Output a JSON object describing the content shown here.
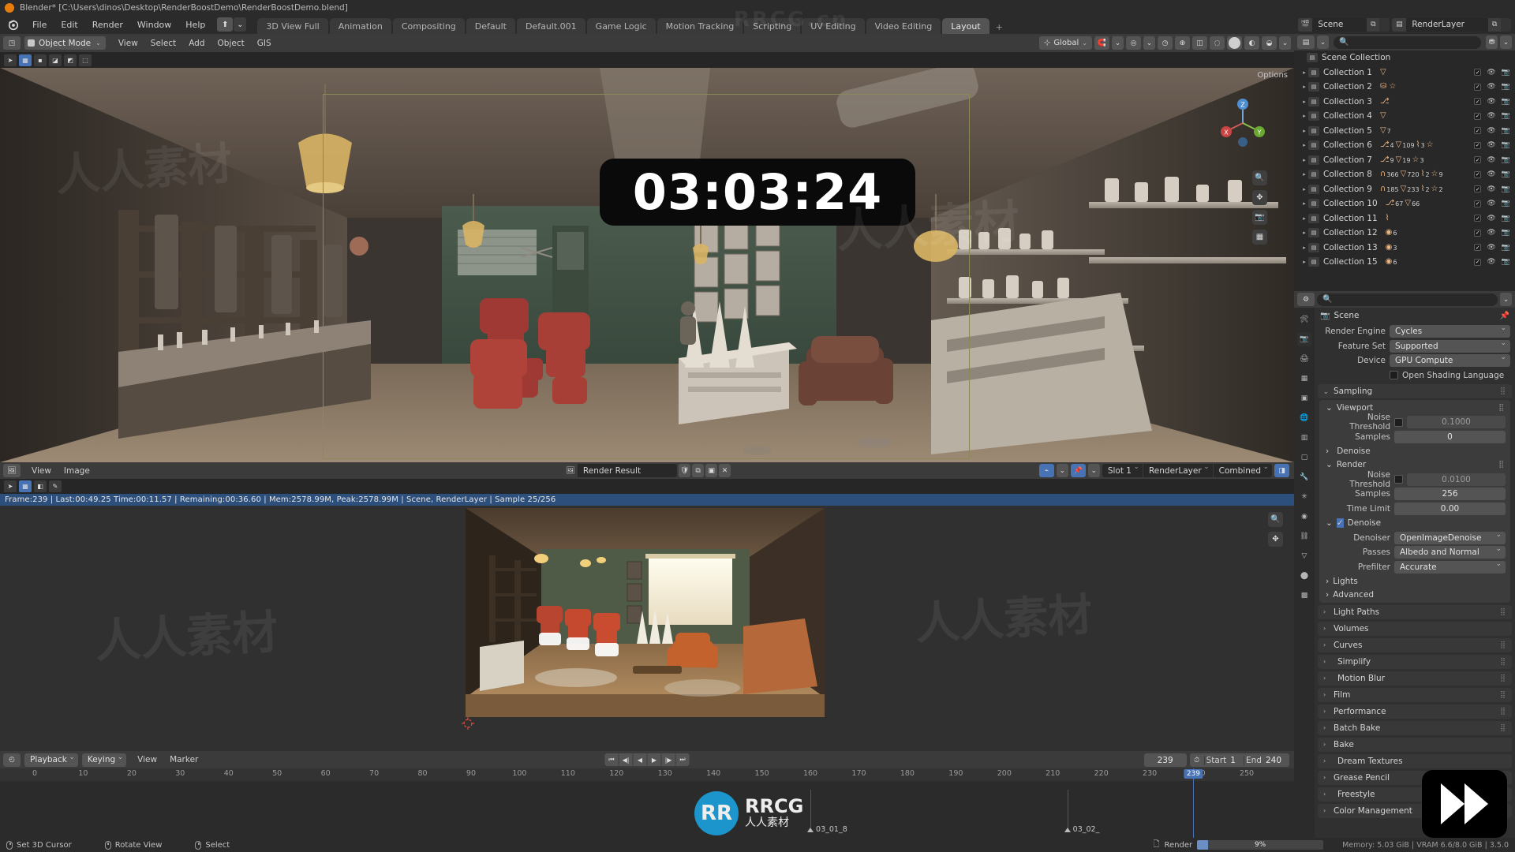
{
  "titlebar": {
    "text": "Blender* [C:\\Users\\dinos\\Desktop\\RenderBoostDemo\\RenderBoostDemo.blend]"
  },
  "topbar": {
    "menus": [
      "File",
      "Edit",
      "Render",
      "Window",
      "Help"
    ],
    "workspaces": [
      {
        "label": "3D View Full",
        "active": false
      },
      {
        "label": "Animation",
        "active": false
      },
      {
        "label": "Compositing",
        "active": false
      },
      {
        "label": "Default",
        "active": false
      },
      {
        "label": "Default.001",
        "active": false
      },
      {
        "label": "Game Logic",
        "active": false
      },
      {
        "label": "Motion Tracking",
        "active": false
      },
      {
        "label": "Scripting",
        "active": false
      },
      {
        "label": "UV Editing",
        "active": false
      },
      {
        "label": "Video Editing",
        "active": false
      },
      {
        "label": "Layout",
        "active": true
      },
      {
        "label": "+",
        "active": false
      }
    ],
    "scene_name": "Scene",
    "view_layer_name": "RenderLayer"
  },
  "viewport": {
    "mode": "Object Mode",
    "menus": [
      "View",
      "Select",
      "Add",
      "Object",
      "GIS"
    ],
    "transform_orientation": "Global",
    "options_label": "Options",
    "timer_overlay": "03:03:24"
  },
  "image_editor": {
    "menus": [
      "View",
      "Image"
    ],
    "image_name": "Render Result",
    "slot": "Slot 1",
    "layer": "RenderLayer",
    "pass": "Combined",
    "render_status": "Frame:239 | Last:00:49.25 Time:00:11.57 | Remaining:00:36.60 | Mem:2578.99M, Peak:2578.99M | Scene, RenderLayer | Sample 25/256"
  },
  "timeline": {
    "popovers": [
      "Playback",
      "Keying"
    ],
    "menus": [
      "View",
      "Marker"
    ],
    "current_frame": "239",
    "start_label": "Start",
    "start_value": "1",
    "end_label": "End",
    "end_value": "240",
    "ruler_ticks": [
      "0",
      "10",
      "20",
      "30",
      "40",
      "50",
      "60",
      "70",
      "80",
      "90",
      "100",
      "110",
      "120",
      "130",
      "140",
      "150",
      "160",
      "170",
      "180",
      "190",
      "200",
      "210",
      "220",
      "230",
      "240",
      "250"
    ],
    "playhead_label": "239",
    "markers": [
      {
        "name": "03_01_8",
        "frame": 160
      },
      {
        "name": "03_02_",
        "frame": 213
      }
    ]
  },
  "outliner": {
    "search_placeholder": "",
    "root": "Scene Collection",
    "items": [
      {
        "label": "Collection 1",
        "counts": [
          {
            "icon": "▽",
            "num": ""
          }
        ]
      },
      {
        "label": "Collection 2",
        "counts": [
          {
            "icon": "⛁",
            "num": ""
          },
          {
            "icon": "☆",
            "num": ""
          }
        ]
      },
      {
        "label": "Collection 3",
        "counts": [
          {
            "icon": "⎇",
            "num": ""
          }
        ]
      },
      {
        "label": "Collection 4",
        "counts": [
          {
            "icon": "▽",
            "num": ""
          }
        ]
      },
      {
        "label": "Collection 5",
        "counts": [
          {
            "icon": "▽",
            "num": "7"
          }
        ]
      },
      {
        "label": "Collection 6",
        "counts": [
          {
            "icon": "⎇",
            "num": "4"
          },
          {
            "icon": "▽",
            "num": "109"
          },
          {
            "icon": "⌇",
            "num": "3"
          },
          {
            "icon": "☆",
            "num": ""
          }
        ]
      },
      {
        "label": "Collection 7",
        "counts": [
          {
            "icon": "⎇",
            "num": "9"
          },
          {
            "icon": "▽",
            "num": "19"
          },
          {
            "icon": "☆",
            "num": "3"
          }
        ]
      },
      {
        "label": "Collection 8",
        "counts": [
          {
            "icon": "∩",
            "num": "366"
          },
          {
            "icon": "▽",
            "num": "720"
          },
          {
            "icon": "⌇",
            "num": "2"
          },
          {
            "icon": "☆",
            "num": "9"
          }
        ]
      },
      {
        "label": "Collection 9",
        "counts": [
          {
            "icon": "∩",
            "num": "185"
          },
          {
            "icon": "▽",
            "num": "233"
          },
          {
            "icon": "⌇",
            "num": "2"
          },
          {
            "icon": "☆",
            "num": "2"
          }
        ]
      },
      {
        "label": "Collection 10",
        "counts": [
          {
            "icon": "⎇",
            "num": "67"
          },
          {
            "icon": "▽",
            "num": "66"
          }
        ]
      },
      {
        "label": "Collection 11",
        "counts": [
          {
            "icon": "⌇",
            "num": ""
          }
        ]
      },
      {
        "label": "Collection 12",
        "counts": [
          {
            "icon": "◉",
            "num": "6"
          }
        ]
      },
      {
        "label": "Collection 13",
        "counts": [
          {
            "icon": "◉",
            "num": "3"
          }
        ]
      },
      {
        "label": "Collection 15",
        "counts": [
          {
            "icon": "◉",
            "num": "6"
          }
        ]
      }
    ]
  },
  "properties": {
    "search_placeholder": "",
    "breadcrumb": "Scene",
    "render_engine_label": "Render Engine",
    "render_engine": "Cycles",
    "feature_set_label": "Feature Set",
    "feature_set": "Supported",
    "device_label": "Device",
    "device": "GPU Compute",
    "osl_label": "Open Shading Language",
    "sampling_label": "Sampling",
    "viewport_label": "Viewport",
    "viewport_noise_threshold_label": "Noise Threshold",
    "viewport_noise_threshold": "0.1000",
    "viewport_samples_label": "Samples",
    "viewport_samples": "0",
    "viewport_denoise_label": "Denoise",
    "render_label": "Render",
    "render_noise_threshold_label": "Noise Threshold",
    "render_noise_threshold": "0.0100",
    "render_samples_label": "Samples",
    "render_samples": "256",
    "time_limit_label": "Time Limit",
    "time_limit": "0.00",
    "denoise_label": "Denoise",
    "denoiser_label": "Denoiser",
    "denoiser": "OpenImageDenoise",
    "passes_label": "Passes",
    "passes": "Albedo and Normal",
    "prefilter_label": "Prefilter",
    "prefilter": "Accurate",
    "sub_panels": [
      "Lights",
      "Advanced"
    ],
    "panels": [
      {
        "label": "Light Paths",
        "checkbox": false,
        "dots": true
      },
      {
        "label": "Volumes",
        "checkbox": false,
        "dots": false
      },
      {
        "label": "Curves",
        "checkbox": false,
        "dots": true
      },
      {
        "label": "Simplify",
        "checkbox": true,
        "dots": true
      },
      {
        "label": "Motion Blur",
        "checkbox": true,
        "dots": true
      },
      {
        "label": "Film",
        "checkbox": false,
        "dots": true
      },
      {
        "label": "Performance",
        "checkbox": false,
        "dots": true
      },
      {
        "label": "Batch Bake",
        "checkbox": false,
        "dots": true
      },
      {
        "label": "Bake",
        "checkbox": false,
        "dots": false
      },
      {
        "label": "Dream Textures",
        "checkbox": true,
        "dots": false
      },
      {
        "label": "Grease Pencil",
        "checkbox": false,
        "dots": false
      },
      {
        "label": "Freestyle",
        "checkbox": true,
        "dots": false
      },
      {
        "label": "Color Management",
        "checkbox": false,
        "dots": false
      }
    ]
  },
  "statusbar": {
    "hints": [
      {
        "label": "Set 3D Cursor"
      },
      {
        "label": "Rotate View"
      },
      {
        "label": "Select"
      }
    ],
    "render_label": "Render",
    "render_progress": "9%",
    "render_progress_value": 9,
    "memory": "Memory: 5.03 GiB | VRAM 6.6/8.0 GiB | 3.5.0"
  },
  "branding": {
    "mark": "RRCG",
    "sub": "人人素材",
    "logo_letters": "RR"
  }
}
